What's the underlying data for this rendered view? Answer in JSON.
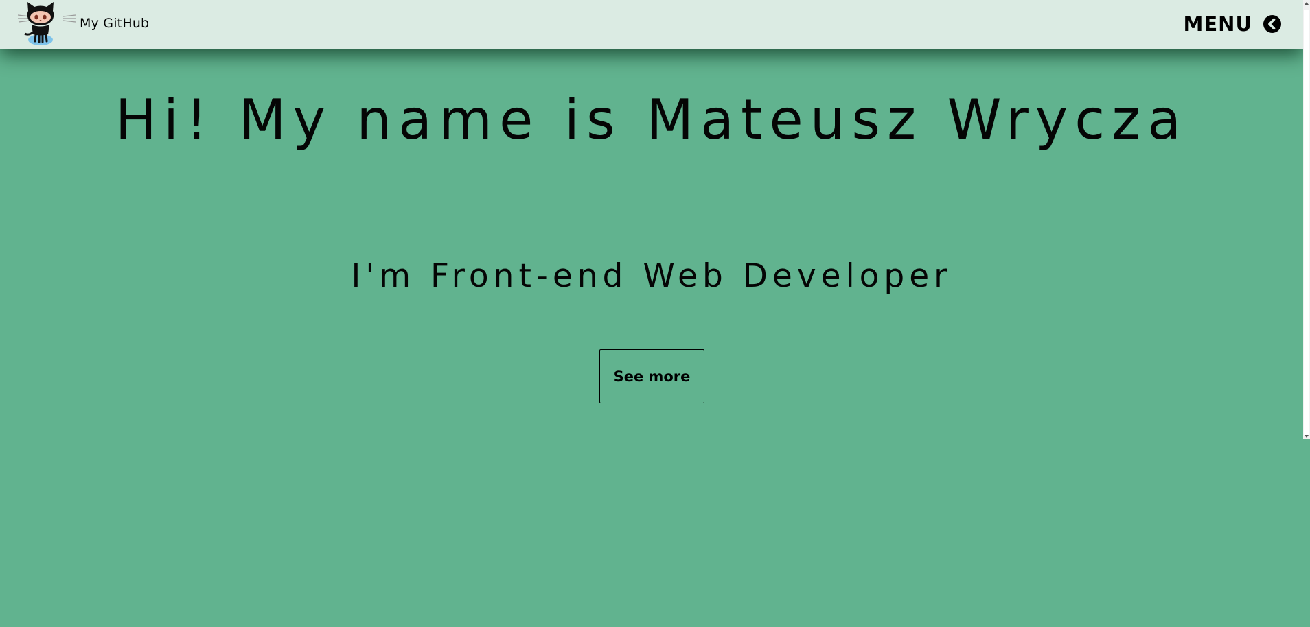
{
  "header": {
    "github_link_label": "My GitHub",
    "github_logo_icon": "octocat-icon",
    "menu_label": "MENU",
    "menu_icon": "chevron-left-circle-icon"
  },
  "hero": {
    "title": "Hi! My name is Mateusz Wrycza",
    "subtitle": "I'm Front-end Web Developer",
    "cta_label": "See more"
  },
  "colors": {
    "header_background": "#dbebe3",
    "page_background": "#61b38f",
    "text": "#000000"
  }
}
